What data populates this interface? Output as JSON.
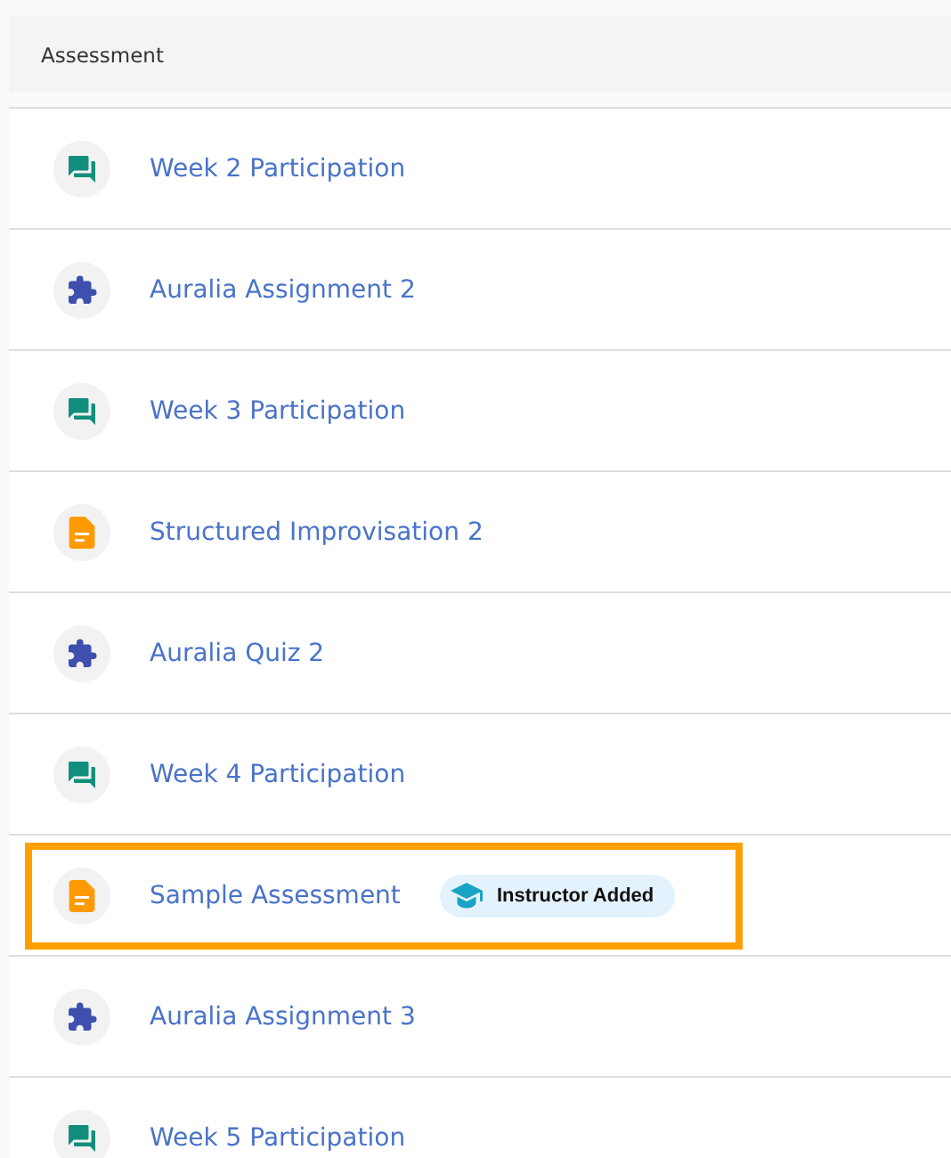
{
  "section": {
    "title": "Assessment"
  },
  "items": [
    {
      "kind": "discussion",
      "title": "Week 2 Participation",
      "highlighted": false
    },
    {
      "kind": "puzzle",
      "title": "Auralia Assignment 2",
      "highlighted": false
    },
    {
      "kind": "discussion",
      "title": "Week 3 Participation",
      "highlighted": false
    },
    {
      "kind": "document",
      "title": "Structured Improvisation 2",
      "highlighted": false
    },
    {
      "kind": "puzzle",
      "title": "Auralia Quiz 2",
      "highlighted": false
    },
    {
      "kind": "discussion",
      "title": "Week 4 Participation",
      "highlighted": false
    },
    {
      "kind": "document",
      "title": "Sample Assessment",
      "highlighted": true,
      "badge": "Instructor Added"
    },
    {
      "kind": "puzzle",
      "title": "Auralia Assignment 3",
      "highlighted": false
    },
    {
      "kind": "discussion",
      "title": "Week 5 Participation",
      "highlighted": false
    }
  ]
}
